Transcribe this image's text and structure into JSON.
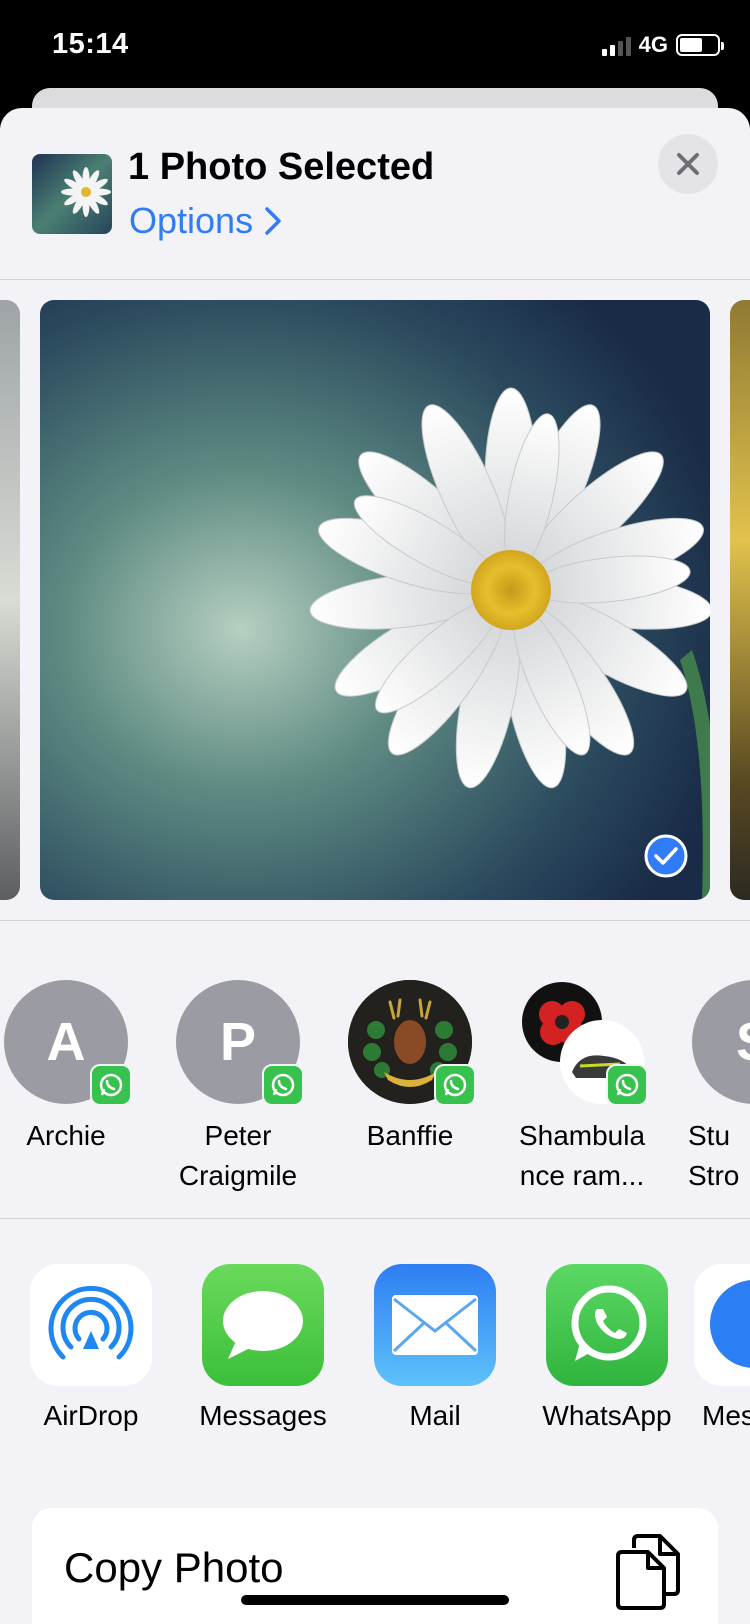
{
  "status_bar": {
    "time": "15:14",
    "network": "4G"
  },
  "header": {
    "title": "1 Photo Selected",
    "options_label": "Options"
  },
  "people": [
    {
      "name_line1": "Archie",
      "name_line2": "",
      "initial": "A",
      "app": "WhatsApp"
    },
    {
      "name_line1": "Peter",
      "name_line2": "Craigmile",
      "initial": "P",
      "app": "WhatsApp"
    },
    {
      "name_line1": "Banffie",
      "name_line2": "",
      "initial": "",
      "app": "WhatsApp"
    },
    {
      "name_line1": "Shambula",
      "name_line2": "nce ram...",
      "initial": "",
      "app": "WhatsApp"
    },
    {
      "name_line1": "Stu",
      "name_line2": "Stro",
      "initial": "S",
      "app": "WhatsApp"
    }
  ],
  "apps": [
    {
      "label": "AirDrop",
      "icon": "airdrop-icon"
    },
    {
      "label": "Messages",
      "icon": "messages-icon"
    },
    {
      "label": "Mail",
      "icon": "mail-icon"
    },
    {
      "label": "WhatsApp",
      "icon": "whatsapp-icon"
    },
    {
      "label": "Mes",
      "icon": "messenger-icon"
    }
  ],
  "actions": [
    {
      "label": "Copy Photo",
      "icon": "copy-icon"
    }
  ],
  "colors": {
    "accent": "#2f7cf6",
    "whatsapp": "#37c24d",
    "sheet_bg": "#f2f2f7"
  }
}
